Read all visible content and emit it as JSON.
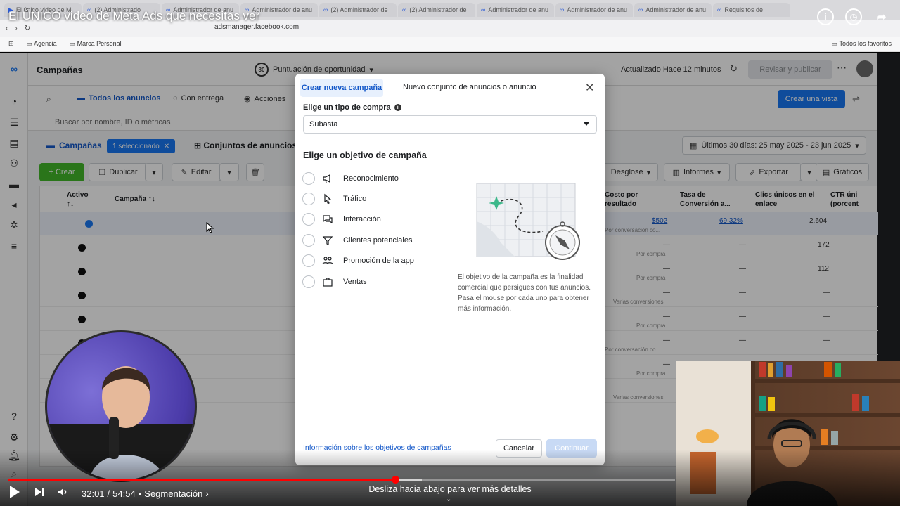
{
  "video": {
    "title": "El ÚNICO video de Meta Ads que necesitas ver",
    "time_current": "32:01",
    "time_total": "54:54",
    "chapter": "Segmentación",
    "swipe_hint": "Desliza hacia abajo para ver más detalles",
    "progress": 0.58,
    "buffered": 0.62
  },
  "browser": {
    "tabs": [
      {
        "label": "El único video de M"
      },
      {
        "label": "(2) Administrado"
      },
      {
        "label": "Administrador de anu"
      },
      {
        "label": "Administrador de anu"
      },
      {
        "label": "(2) Administrador de"
      },
      {
        "label": "(2) Administrador de"
      },
      {
        "label": "Administrador de anu"
      },
      {
        "label": "Administrador de anu"
      },
      {
        "label": "Administrador de anu"
      },
      {
        "label": "Requisitos de"
      }
    ],
    "url": "adsmanager.facebook.com",
    "bookmarks": [
      "Agencia",
      "Marca Personal"
    ],
    "bookmarks_right": "Todos los favoritos"
  },
  "app": {
    "page_title": "Campañas",
    "score_value": "80",
    "score_label": "Puntuación de oportunidad",
    "updated": "Actualizado Hace 12 minutos",
    "review_publish": "Revisar y publicar",
    "filters": {
      "all_ads": "Todos los anuncios",
      "delivery": "Con entrega",
      "actions": "Acciones"
    },
    "create_view": "Crear una vista",
    "search_placeholder": "Buscar por nombre, ID o métricas",
    "levels": {
      "campaigns": "Campañas",
      "selected": "1 seleccionado",
      "adsets": "Conjuntos de anuncios"
    },
    "daterange": "Últimos 30 días: 25 may 2025 - 23 jun 2025",
    "toolbar": {
      "create": "Crear",
      "duplicate": "Duplicar",
      "edit": "Editar",
      "breakdown": "Desglose",
      "reports": "Informes",
      "export": "Exportar",
      "charts": "Gráficos"
    },
    "table": {
      "headers": {
        "active": "Activo",
        "campaign": "Campaña",
        "cost": "Costo por resultado",
        "conv_rate": "Tasa de Conversión a...",
        "unique_clicks": "Clics únicos en el enlace",
        "ctr": "CTR úni (porcent"
      },
      "rows": [
        {
          "cost": "$502",
          "cost_sub": "Por conversación co...",
          "rate": "69,32%",
          "clicks": "2.604"
        },
        {
          "cost": "—",
          "cost_sub": "Por compra",
          "rate": "—",
          "clicks": "172"
        },
        {
          "cost": "—",
          "cost_sub": "Por compra",
          "rate": "—",
          "clicks": "112"
        },
        {
          "cost": "—",
          "cost_sub": "Varias conversiones",
          "rate": "—",
          "clicks": "—"
        },
        {
          "cost": "—",
          "cost_sub": "Por compra",
          "rate": "—",
          "clicks": "—"
        },
        {
          "cost": "—",
          "cost_sub": "Por conversación co...",
          "rate": "—",
          "clicks": "—"
        },
        {
          "cost": "—",
          "cost_sub": "Por compra",
          "rate": "—",
          "clicks": "—"
        },
        {
          "cost": "",
          "cost_sub": "Varias conversiones",
          "rate": "",
          "clicks": ""
        }
      ]
    }
  },
  "modal": {
    "tab_new_campaign": "Crear nueva campaña",
    "tab_new_set": "Nuevo conjunto de anuncios o anuncio",
    "buy_type_label": "Elige un tipo de compra",
    "buy_type_value": "Subasta",
    "objective_heading": "Elige un objetivo de campaña",
    "objectives": [
      {
        "label": "Reconocimiento",
        "icon": "megaphone-icon"
      },
      {
        "label": "Tráfico",
        "icon": "cursor-icon"
      },
      {
        "label": "Interacción",
        "icon": "chat-bubbles-icon"
      },
      {
        "label": "Clientes potenciales",
        "icon": "funnel-icon"
      },
      {
        "label": "Promoción de la app",
        "icon": "people-icon"
      },
      {
        "label": "Ventas",
        "icon": "briefcase-icon"
      }
    ],
    "description": "El objetivo de la campaña es la finalidad comercial que persigues con tus anuncios. Pasa el mouse por cada uno para obtener más información.",
    "footer_link": "Información sobre los objetivos de campañas",
    "cancel": "Cancelar",
    "continue": "Continuar"
  },
  "colors": {
    "accent": "#1877f2",
    "create_green": "#42b72a",
    "progress_red": "#ff0000"
  }
}
